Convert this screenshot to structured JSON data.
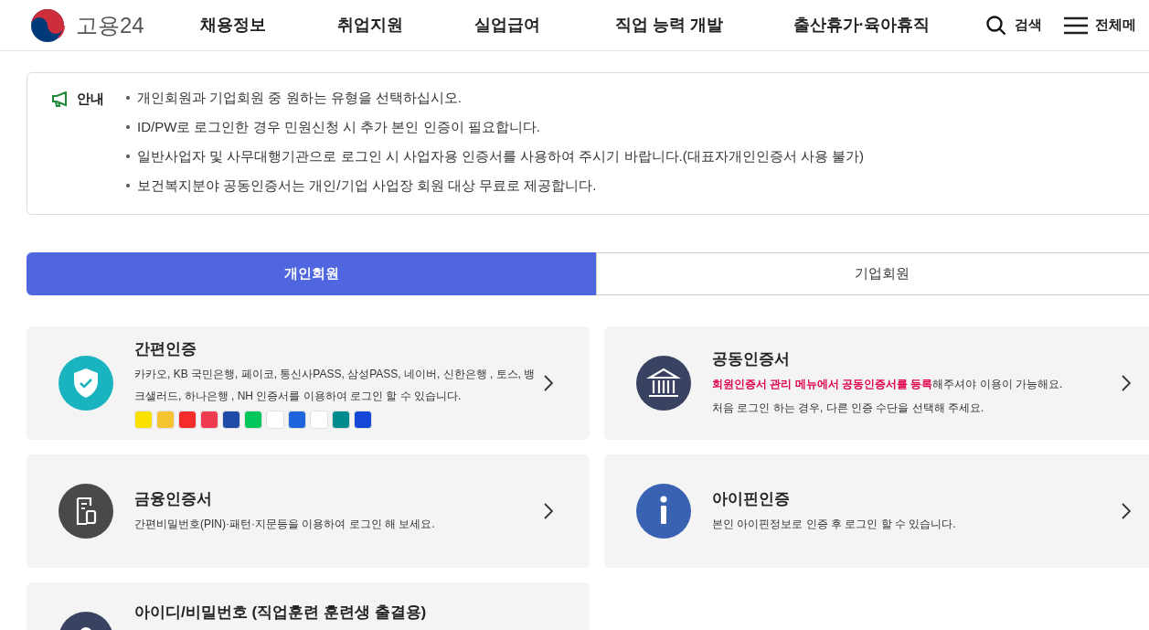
{
  "header": {
    "logo_text": "고용24",
    "nav": [
      "채용정보",
      "취업지원",
      "실업급여",
      "직업 능력 개발",
      "출산휴가·육아휴직"
    ],
    "search_label": "검색",
    "menu_label": "전체메"
  },
  "notice": {
    "label": "안내",
    "items": [
      "개인회원과 기업회원 중 원하는 유형을 선택하십시오.",
      "ID/PW로 로그인한 경우 민원신청 시 추가 본인 인증이 필요합니다.",
      "일반사업자 및 사무대행기관으로 로그인 시 사업자용 인증서를 사용하여 주시기 바랍니다.(대표자개인인증서 사용 불가)",
      "보건복지분야 공동인증서는 개인/기업 사업장 회원 대상 무료로 제공합니다."
    ]
  },
  "tabs": [
    {
      "label": "개인회원",
      "selected": true
    },
    {
      "label": "기업회원",
      "selected": false
    }
  ],
  "cards": [
    {
      "kind": "shield",
      "title": "간편인증",
      "lines": [
        "카카오, KB 국민은행, 페이코, 통신사PASS, 삼성PASS, 네이버, 신한은행 , 토스, 뱅크샐러드, 하나은행 , NH 인증서를 이용하여 로그인 할 수 있습니다."
      ],
      "provider_icons": [
        {
          "color": "#fae100"
        },
        {
          "color": "#f5c431"
        },
        {
          "color": "#f42c2c"
        },
        {
          "color": "#ee3b4f"
        },
        {
          "color": "#1f4aa8"
        },
        {
          "color": "#03c75a"
        },
        {
          "color": "#ffffff"
        },
        {
          "color": "#1b64da"
        },
        {
          "color": "#ffffff"
        },
        {
          "color": "#008c8c"
        },
        {
          "color": "#1447d6"
        }
      ]
    },
    {
      "kind": "bank",
      "title": "공동인증서",
      "lines": [
        "**회원인증서 관리 메뉴에서 공동인증서를 등록**해주셔야 이용이 가능해요.",
        "처음 로그인 하는 경우, 다른 인증 수단을 선택해 주세요."
      ]
    },
    {
      "kind": "document",
      "title": "금융인증서",
      "lines": [
        "간편비밀번호(PIN)·패턴·지문등을 이용하여 로그인 해 보세요."
      ]
    },
    {
      "kind": "info",
      "title": "아이핀인증",
      "lines": [
        "본인 아이핀정보로 인증 후 로그인 할 수 있습니다."
      ]
    },
    {
      "kind": "person",
      "title": "아이디/비밀번호 (직업훈련 훈련생 출결용)"
    }
  ]
}
